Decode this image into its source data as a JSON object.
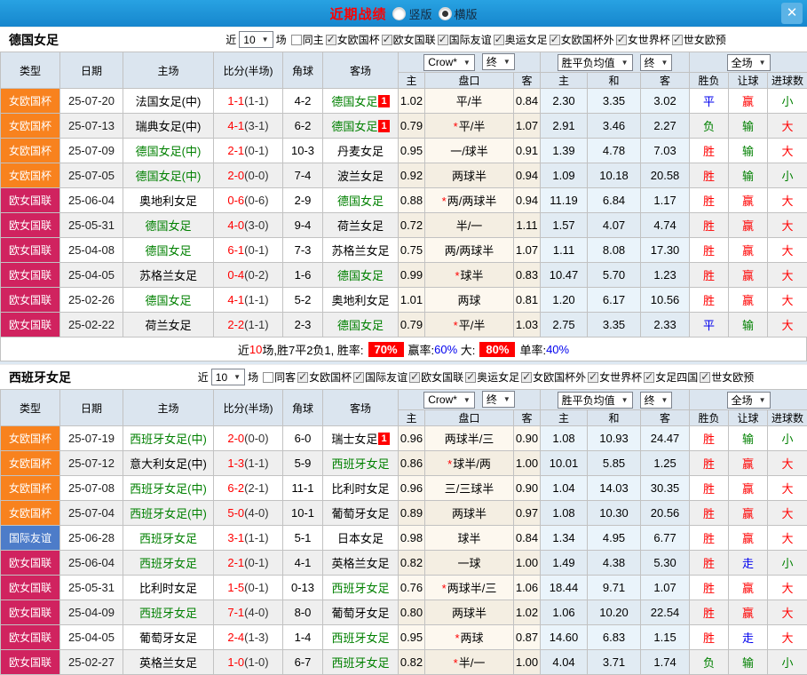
{
  "titlebar": {
    "title": "近期战绩",
    "options": [
      {
        "label": "竖版",
        "checked": false
      },
      {
        "label": "横版",
        "checked": true
      }
    ]
  },
  "type_colors": {
    "女欧国杯": "#f8821e",
    "欧女国联": "#d0235f",
    "国际友谊": "#4d7cc9"
  },
  "table_header": {
    "cols": [
      "类型",
      "日期",
      "主场",
      "比分(半场)",
      "角球",
      "客场"
    ],
    "dd_company": "Crow*",
    "dd_final1": "终",
    "dd_avg": "胜平负均值",
    "dd_final2": "终",
    "dd_scope": "全场",
    "sub1": [
      "主",
      "盘口",
      "客"
    ],
    "sub2": [
      "主",
      "和",
      "客"
    ],
    "sub3": [
      "胜负",
      "让球",
      "进球数"
    ]
  },
  "sections": [
    {
      "team": "德国女足",
      "filter": {
        "near": "近",
        "count": "10",
        "games": "场",
        "uncheck": "同主",
        "checks": [
          "女欧国杯",
          "欧女国联",
          "国际友谊",
          "奥运女足",
          "女欧国杯外",
          "女世界杯",
          "世女欧预"
        ]
      },
      "rows": [
        {
          "type": "女欧国杯",
          "date": "25-07-20",
          "home": "法国女足(中)",
          "hg": false,
          "score": "1-1",
          "half": "(1-1)",
          "corner": "4-2",
          "away": "德国女足",
          "ag": true,
          "badge": "1",
          "o1": "1.02",
          "star": false,
          "hcp": "平/半",
          "o2": "0.84",
          "a1": "2.30",
          "a2": "3.35",
          "a3": "3.02",
          "wdl": [
            "平",
            "blue"
          ],
          "hr": [
            "赢",
            "red"
          ],
          "ou": [
            "小",
            "green"
          ]
        },
        {
          "type": "女欧国杯",
          "date": "25-07-13",
          "home": "瑞典女足(中)",
          "hg": false,
          "score": "4-1",
          "half": "(3-1)",
          "corner": "6-2",
          "away": "德国女足",
          "ag": true,
          "badge": "1",
          "o1": "0.79",
          "star": true,
          "hcp": "平/半",
          "o2": "1.07",
          "a1": "2.91",
          "a2": "3.46",
          "a3": "2.27",
          "wdl": [
            "负",
            "green"
          ],
          "hr": [
            "输",
            "green"
          ],
          "ou": [
            "大",
            "red"
          ]
        },
        {
          "type": "女欧国杯",
          "date": "25-07-09",
          "home": "德国女足(中)",
          "hg": true,
          "score": "2-1",
          "half": "(0-1)",
          "corner": "10-3",
          "away": "丹麦女足",
          "ag": false,
          "badge": "",
          "o1": "0.95",
          "star": false,
          "hcp": "一/球半",
          "o2": "0.91",
          "a1": "1.39",
          "a2": "4.78",
          "a3": "7.03",
          "wdl": [
            "胜",
            "red"
          ],
          "hr": [
            "输",
            "green"
          ],
          "ou": [
            "大",
            "red"
          ]
        },
        {
          "type": "女欧国杯",
          "date": "25-07-05",
          "home": "德国女足(中)",
          "hg": true,
          "score": "2-0",
          "half": "(0-0)",
          "corner": "7-4",
          "away": "波兰女足",
          "ag": false,
          "badge": "",
          "o1": "0.92",
          "star": false,
          "hcp": "两球半",
          "o2": "0.94",
          "a1": "1.09",
          "a2": "10.18",
          "a3": "20.58",
          "wdl": [
            "胜",
            "red"
          ],
          "hr": [
            "输",
            "green"
          ],
          "ou": [
            "小",
            "green"
          ]
        },
        {
          "type": "欧女国联",
          "date": "25-06-04",
          "home": "奥地利女足",
          "hg": false,
          "score": "0-6",
          "half": "(0-6)",
          "corner": "2-9",
          "away": "德国女足",
          "ag": true,
          "badge": "",
          "o1": "0.88",
          "star": true,
          "hcp": "两/两球半",
          "o2": "0.94",
          "a1": "11.19",
          "a2": "6.84",
          "a3": "1.17",
          "wdl": [
            "胜",
            "red"
          ],
          "hr": [
            "赢",
            "red"
          ],
          "ou": [
            "大",
            "red"
          ]
        },
        {
          "type": "欧女国联",
          "date": "25-05-31",
          "home": "德国女足",
          "hg": true,
          "score": "4-0",
          "half": "(3-0)",
          "corner": "9-4",
          "away": "荷兰女足",
          "ag": false,
          "badge": "",
          "o1": "0.72",
          "star": false,
          "hcp": "半/一",
          "o2": "1.11",
          "a1": "1.57",
          "a2": "4.07",
          "a3": "4.74",
          "wdl": [
            "胜",
            "red"
          ],
          "hr": [
            "赢",
            "red"
          ],
          "ou": [
            "大",
            "red"
          ]
        },
        {
          "type": "欧女国联",
          "date": "25-04-08",
          "home": "德国女足",
          "hg": true,
          "score": "6-1",
          "half": "(0-1)",
          "corner": "7-3",
          "away": "苏格兰女足",
          "ag": false,
          "badge": "",
          "o1": "0.75",
          "star": false,
          "hcp": "两/两球半",
          "o2": "1.07",
          "a1": "1.11",
          "a2": "8.08",
          "a3": "17.30",
          "wdl": [
            "胜",
            "red"
          ],
          "hr": [
            "赢",
            "red"
          ],
          "ou": [
            "大",
            "red"
          ]
        },
        {
          "type": "欧女国联",
          "date": "25-04-05",
          "home": "苏格兰女足",
          "hg": false,
          "score": "0-4",
          "half": "(0-2)",
          "corner": "1-6",
          "away": "德国女足",
          "ag": true,
          "badge": "",
          "o1": "0.99",
          "star": true,
          "hcp": "球半",
          "o2": "0.83",
          "a1": "10.47",
          "a2": "5.70",
          "a3": "1.23",
          "wdl": [
            "胜",
            "red"
          ],
          "hr": [
            "赢",
            "red"
          ],
          "ou": [
            "大",
            "red"
          ]
        },
        {
          "type": "欧女国联",
          "date": "25-02-26",
          "home": "德国女足",
          "hg": true,
          "score": "4-1",
          "half": "(1-1)",
          "corner": "5-2",
          "away": "奥地利女足",
          "ag": false,
          "badge": "",
          "o1": "1.01",
          "star": false,
          "hcp": "两球",
          "o2": "0.81",
          "a1": "1.20",
          "a2": "6.17",
          "a3": "10.56",
          "wdl": [
            "胜",
            "red"
          ],
          "hr": [
            "赢",
            "red"
          ],
          "ou": [
            "大",
            "red"
          ]
        },
        {
          "type": "欧女国联",
          "date": "25-02-22",
          "home": "荷兰女足",
          "hg": false,
          "score": "2-2",
          "half": "(1-1)",
          "corner": "2-3",
          "away": "德国女足",
          "ag": true,
          "badge": "",
          "o1": "0.79",
          "star": true,
          "hcp": "平/半",
          "o2": "1.03",
          "a1": "2.75",
          "a2": "3.35",
          "a3": "2.33",
          "wdl": [
            "平",
            "blue"
          ],
          "hr": [
            "输",
            "green"
          ],
          "ou": [
            "大",
            "red"
          ]
        }
      ],
      "summary": [
        [
          "近",
          "black"
        ],
        [
          "10",
          "red"
        ],
        [
          "场,胜7平2负1, 胜率:",
          "black"
        ],
        [
          "70%",
          "chip"
        ],
        [
          "赢率:",
          "black"
        ],
        [
          "60%",
          "blue"
        ],
        [
          " 大:",
          "black"
        ],
        [
          "80%",
          "chip"
        ],
        [
          "单率:",
          "black"
        ],
        [
          "40%",
          "blue"
        ]
      ]
    },
    {
      "team": "西班牙女足",
      "filter": {
        "near": "近",
        "count": "10",
        "games": "场",
        "uncheck": "同客",
        "checks": [
          "女欧国杯",
          "国际友谊",
          "欧女国联",
          "奥运女足",
          "女欧国杯外",
          "女世界杯",
          "女足四国",
          "世女欧预"
        ]
      },
      "rows": [
        {
          "type": "女欧国杯",
          "date": "25-07-19",
          "home": "西班牙女足(中)",
          "hg": true,
          "score": "2-0",
          "half": "(0-0)",
          "corner": "6-0",
          "away": "瑞士女足",
          "ag": false,
          "badge": "1",
          "o1": "0.96",
          "star": false,
          "hcp": "两球半/三",
          "o2": "0.90",
          "a1": "1.08",
          "a2": "10.93",
          "a3": "24.47",
          "wdl": [
            "胜",
            "red"
          ],
          "hr": [
            "输",
            "green"
          ],
          "ou": [
            "小",
            "green"
          ]
        },
        {
          "type": "女欧国杯",
          "date": "25-07-12",
          "home": "意大利女足(中)",
          "hg": false,
          "score": "1-3",
          "half": "(1-1)",
          "corner": "5-9",
          "away": "西班牙女足",
          "ag": true,
          "badge": "",
          "o1": "0.86",
          "star": true,
          "hcp": "球半/两",
          "o2": "1.00",
          "a1": "10.01",
          "a2": "5.85",
          "a3": "1.25",
          "wdl": [
            "胜",
            "red"
          ],
          "hr": [
            "赢",
            "red"
          ],
          "ou": [
            "大",
            "red"
          ]
        },
        {
          "type": "女欧国杯",
          "date": "25-07-08",
          "home": "西班牙女足(中)",
          "hg": true,
          "score": "6-2",
          "half": "(2-1)",
          "corner": "11-1",
          "away": "比利时女足",
          "ag": false,
          "badge": "",
          "o1": "0.96",
          "star": false,
          "hcp": "三/三球半",
          "o2": "0.90",
          "a1": "1.04",
          "a2": "14.03",
          "a3": "30.35",
          "wdl": [
            "胜",
            "red"
          ],
          "hr": [
            "赢",
            "red"
          ],
          "ou": [
            "大",
            "red"
          ]
        },
        {
          "type": "女欧国杯",
          "date": "25-07-04",
          "home": "西班牙女足(中)",
          "hg": true,
          "score": "5-0",
          "half": "(4-0)",
          "corner": "10-1",
          "away": "葡萄牙女足",
          "ag": false,
          "badge": "",
          "o1": "0.89",
          "star": false,
          "hcp": "两球半",
          "o2": "0.97",
          "a1": "1.08",
          "a2": "10.30",
          "a3": "20.56",
          "wdl": [
            "胜",
            "red"
          ],
          "hr": [
            "赢",
            "red"
          ],
          "ou": [
            "大",
            "red"
          ]
        },
        {
          "type": "国际友谊",
          "date": "25-06-28",
          "home": "西班牙女足",
          "hg": true,
          "score": "3-1",
          "half": "(1-1)",
          "corner": "5-1",
          "away": "日本女足",
          "ag": false,
          "badge": "",
          "o1": "0.98",
          "star": false,
          "hcp": "球半",
          "o2": "0.84",
          "a1": "1.34",
          "a2": "4.95",
          "a3": "6.77",
          "wdl": [
            "胜",
            "red"
          ],
          "hr": [
            "赢",
            "red"
          ],
          "ou": [
            "大",
            "red"
          ]
        },
        {
          "type": "欧女国联",
          "date": "25-06-04",
          "home": "西班牙女足",
          "hg": true,
          "score": "2-1",
          "half": "(0-1)",
          "corner": "4-1",
          "away": "英格兰女足",
          "ag": false,
          "badge": "",
          "o1": "0.82",
          "star": false,
          "hcp": "一球",
          "o2": "1.00",
          "a1": "1.49",
          "a2": "4.38",
          "a3": "5.30",
          "wdl": [
            "胜",
            "red"
          ],
          "hr": [
            "走",
            "blue"
          ],
          "ou": [
            "小",
            "green"
          ]
        },
        {
          "type": "欧女国联",
          "date": "25-05-31",
          "home": "比利时女足",
          "hg": false,
          "score": "1-5",
          "half": "(0-1)",
          "corner": "0-13",
          "away": "西班牙女足",
          "ag": true,
          "badge": "",
          "o1": "0.76",
          "star": true,
          "hcp": "两球半/三",
          "o2": "1.06",
          "a1": "18.44",
          "a2": "9.71",
          "a3": "1.07",
          "wdl": [
            "胜",
            "red"
          ],
          "hr": [
            "赢",
            "red"
          ],
          "ou": [
            "大",
            "red"
          ]
        },
        {
          "type": "欧女国联",
          "date": "25-04-09",
          "home": "西班牙女足",
          "hg": true,
          "score": "7-1",
          "half": "(4-0)",
          "corner": "8-0",
          "away": "葡萄牙女足",
          "ag": false,
          "badge": "",
          "o1": "0.80",
          "star": false,
          "hcp": "两球半",
          "o2": "1.02",
          "a1": "1.06",
          "a2": "10.20",
          "a3": "22.54",
          "wdl": [
            "胜",
            "red"
          ],
          "hr": [
            "赢",
            "red"
          ],
          "ou": [
            "大",
            "red"
          ]
        },
        {
          "type": "欧女国联",
          "date": "25-04-05",
          "home": "葡萄牙女足",
          "hg": false,
          "score": "2-4",
          "half": "(1-3)",
          "corner": "1-4",
          "away": "西班牙女足",
          "ag": true,
          "badge": "",
          "o1": "0.95",
          "star": true,
          "hcp": "两球",
          "o2": "0.87",
          "a1": "14.60",
          "a2": "6.83",
          "a3": "1.15",
          "wdl": [
            "胜",
            "red"
          ],
          "hr": [
            "走",
            "blue"
          ],
          "ou": [
            "大",
            "red"
          ]
        },
        {
          "type": "欧女国联",
          "date": "25-02-27",
          "home": "英格兰女足",
          "hg": false,
          "score": "1-0",
          "half": "(1-0)",
          "corner": "6-7",
          "away": "西班牙女足",
          "ag": true,
          "badge": "",
          "o1": "0.82",
          "star": true,
          "hcp": "半/一",
          "o2": "1.00",
          "a1": "4.04",
          "a2": "3.71",
          "a3": "1.74",
          "wdl": [
            "负",
            "green"
          ],
          "hr": [
            "输",
            "green"
          ],
          "ou": [
            "小",
            "green"
          ]
        }
      ],
      "summary": null
    }
  ]
}
